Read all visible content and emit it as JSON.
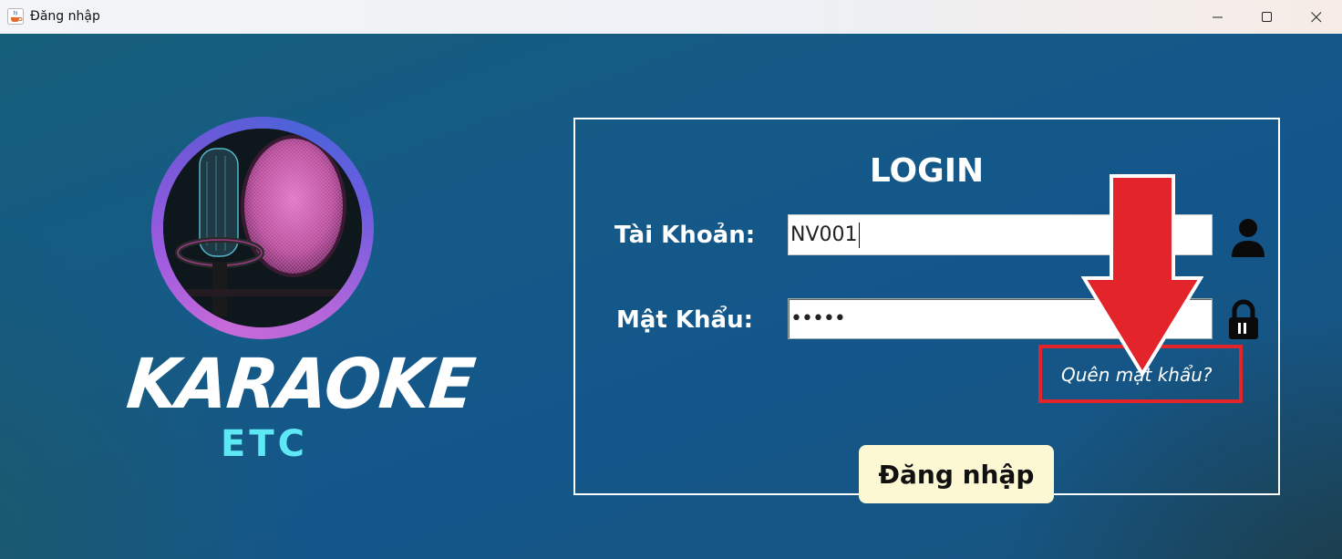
{
  "window": {
    "title": "Đăng nhập",
    "icon": "java-cup-icon",
    "controls": [
      "minimize-icon",
      "maximize-icon",
      "close-icon"
    ]
  },
  "logo": {
    "line1": "KARAOKE",
    "line2": "ETC",
    "line2_color": "#5ee8f5"
  },
  "login": {
    "heading": "LOGIN",
    "username_label": "Tài Khoản:",
    "username_value": "NV001",
    "password_label": "Mật Khẩu:",
    "password_value": "•••••",
    "forgot_link": "Quên mật khẩu?",
    "submit_label": "Đăng nhập",
    "user_icon": "user-icon",
    "lock_icon": "lock-icon"
  },
  "annotation": {
    "arrow_color": "#e3242b",
    "box_color": "#e3242b"
  }
}
